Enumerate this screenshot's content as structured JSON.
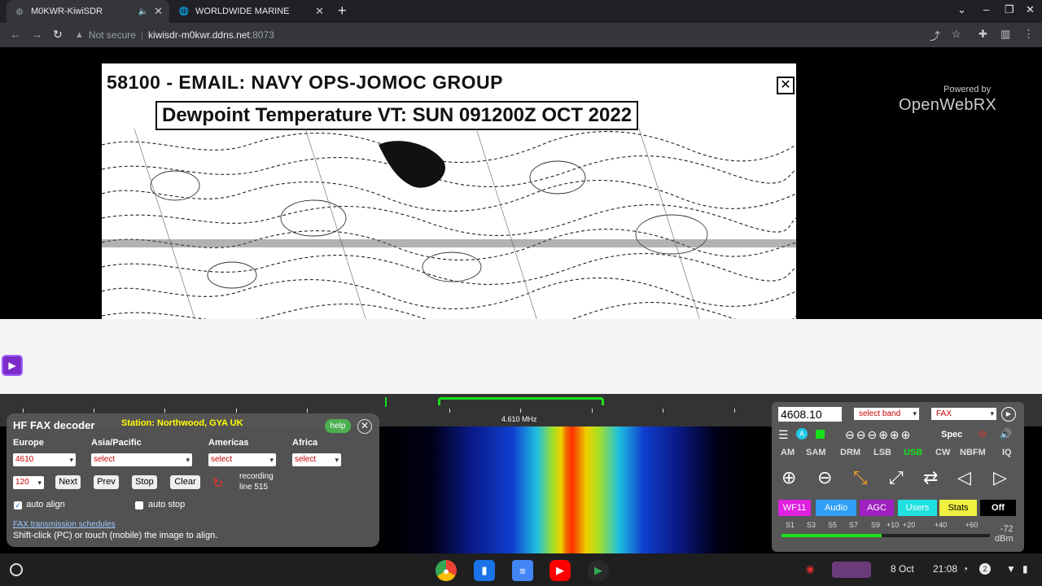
{
  "browser": {
    "tabs": [
      {
        "label": "M0KWR-KiwiSDR"
      },
      {
        "label": "WORLDWIDE MARINE"
      }
    ],
    "url": {
      "security": "Not secure",
      "host": "kiwisdr-m0kwr.ddns.net",
      "port": ":8073"
    }
  },
  "fax_image": {
    "line1": "58100 - EMAIL: NAVY OPS-JOMOC GROUP",
    "line2": "Dewpoint Temperature VT: SUN 091200Z OCT 2022"
  },
  "branding": {
    "powered": "Powered by",
    "name": "OpenWebRX"
  },
  "scale": {
    "center_freq": "4.610 MHz"
  },
  "fax_panel": {
    "title": "HF FAX decoder",
    "station": "Station: Northwood, GYA UK",
    "help": "help",
    "regions": [
      {
        "label": "Europe",
        "value": "4610"
      },
      {
        "label": "Asia/Pacific",
        "value": "select"
      },
      {
        "label": "Americas",
        "value": "select"
      },
      {
        "label": "Africa",
        "value": "select"
      }
    ],
    "lpm": "120",
    "buttons": {
      "next": "Next",
      "prev": "Prev",
      "stop": "Stop",
      "clear": "Clear"
    },
    "recording": {
      "line1": "recording",
      "line2": "line 515"
    },
    "auto_align": {
      "label": "auto align",
      "checked": true
    },
    "auto_stop": {
      "label": "auto stop",
      "checked": false
    },
    "schedules": "FAX transmission schedules",
    "hint": "Shift-click (PC) or touch (mobile) the image to align."
  },
  "control_panel": {
    "frequency": "4608.10",
    "band": "select band",
    "mode_select": "FAX",
    "spec": "Spec",
    "modes": [
      "AM",
      "SAM",
      "DRM",
      "LSB",
      "USB",
      "CW",
      "NBFM",
      "IQ"
    ],
    "active_mode": "USB",
    "tabs": [
      {
        "label": "WF11",
        "color": "#e020e0"
      },
      {
        "label": "Audio",
        "color": "#2e9ff5"
      },
      {
        "label": "AGC",
        "color": "#a020c0"
      },
      {
        "label": "Users",
        "color": "#20e0e0"
      },
      {
        "label": "Stats",
        "color": "#f0f040"
      },
      {
        "label": "Off",
        "color": "#000000"
      }
    ],
    "smeter": {
      "labels": [
        "S1",
        "S3",
        "S5",
        "S7",
        "S9",
        "+10",
        "+20",
        "+40",
        "+60"
      ],
      "value": "-72",
      "unit": "dBm",
      "level": 0.48
    }
  },
  "shelf": {
    "date": "8 Oct",
    "time": "21:08",
    "notifications": "2"
  }
}
